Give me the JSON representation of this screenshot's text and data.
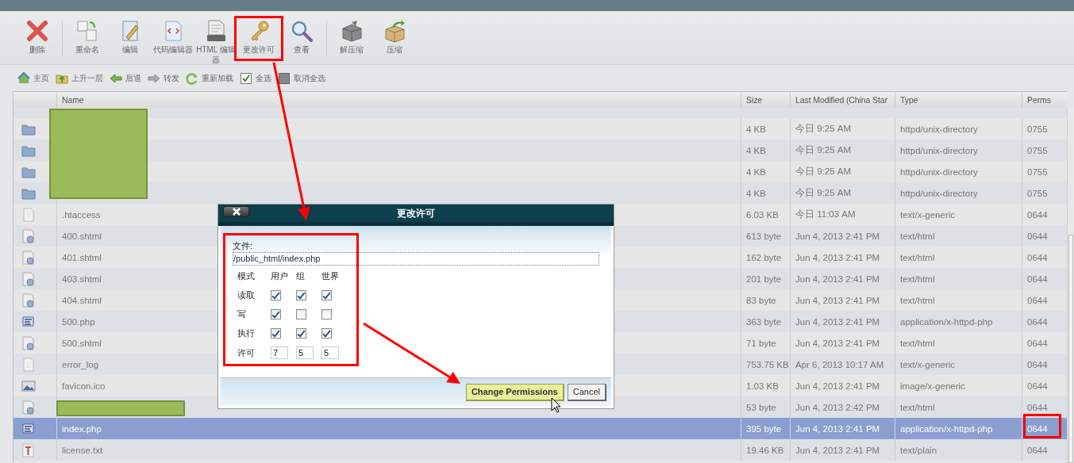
{
  "toolbar": {
    "items": [
      {
        "kind": "delete",
        "label": "删除"
      },
      {
        "kind": "separator"
      },
      {
        "kind": "rename",
        "label": "重命名"
      },
      {
        "kind": "edit",
        "label": "编辑"
      },
      {
        "kind": "code-editor",
        "label": "代码编辑器"
      },
      {
        "kind": "html-editor",
        "label": "HTML 编辑器"
      },
      {
        "kind": "permissions",
        "label": "更改许可"
      },
      {
        "kind": "view",
        "label": "查看"
      },
      {
        "kind": "separator"
      },
      {
        "kind": "extract",
        "label": "解压缩"
      },
      {
        "kind": "compress",
        "label": "压缩"
      }
    ]
  },
  "navbar": {
    "items": [
      {
        "kind": "home",
        "label": "主页"
      },
      {
        "kind": "up",
        "label": "上升一层"
      },
      {
        "kind": "back",
        "label": "后退"
      },
      {
        "kind": "forward",
        "label": "转发"
      },
      {
        "kind": "reload",
        "label": "重新加载"
      },
      {
        "kind": "select-all",
        "label": "全选"
      },
      {
        "kind": "deselect-all",
        "label": "取消全选"
      }
    ]
  },
  "table": {
    "columns": [
      "Name",
      "Size",
      "Last Modified (China Star",
      "Type",
      "Perms"
    ],
    "rows": [
      {
        "kind": "folder",
        "size": "4 KB",
        "modified": "今日 9:25 AM",
        "type": "httpd/unix-directory",
        "perms": "0755",
        "selected": false
      },
      {
        "kind": "folder",
        "size": "4 KB",
        "modified": "今日 9:25 AM",
        "type": "httpd/unix-directory",
        "perms": "0755",
        "selected": false
      },
      {
        "kind": "folder",
        "size": "4 KB",
        "modified": "今日 9:25 AM",
        "type": "httpd/unix-directory",
        "perms": "0755",
        "selected": false
      },
      {
        "kind": "folder",
        "size": "4 KB",
        "modified": "今日 9:25 AM",
        "type": "httpd/unix-directory",
        "perms": "0755",
        "selected": false
      },
      {
        "kind": "doc",
        "name": ".htaccess",
        "size": "6.03 KB",
        "modified": "今日 11:03 AM",
        "type": "text/x-generic",
        "perms": "0644",
        "selected": false
      },
      {
        "kind": "web",
        "name": "400.shtml",
        "size": "613 byte",
        "modified": "Jun 4, 2013 2:41 PM",
        "type": "text/html",
        "perms": "0644",
        "selected": false
      },
      {
        "kind": "web",
        "name": "401.shtml",
        "size": "162 byte",
        "modified": "Jun 4, 2013 2:41 PM",
        "type": "text/html",
        "perms": "0644",
        "selected": false
      },
      {
        "kind": "web",
        "name": "403.shtml",
        "size": "201 byte",
        "modified": "Jun 4, 2013 2:41 PM",
        "type": "text/html",
        "perms": "0644",
        "selected": false
      },
      {
        "kind": "web",
        "name": "404.shtml",
        "size": "83 byte",
        "modified": "Jun 4, 2013 2:41 PM",
        "type": "text/html",
        "perms": "0644",
        "selected": false
      },
      {
        "kind": "php",
        "name": "500.php",
        "size": "363 byte",
        "modified": "Jun 4, 2013 2:41 PM",
        "type": "application/x-httpd-php",
        "perms": "0644",
        "selected": false
      },
      {
        "kind": "web",
        "name": "500.shtml",
        "size": "71 byte",
        "modified": "Jun 4, 2013 2:41 PM",
        "type": "text/html",
        "perms": "0644",
        "selected": false
      },
      {
        "kind": "doc",
        "name": "error_log",
        "size": "753.75 KB",
        "modified": "Apr 6, 2013 10:17 AM",
        "type": "text/x-generic",
        "perms": "0644",
        "selected": false
      },
      {
        "kind": "image",
        "name": "favicon.ico",
        "size": "1.03 KB",
        "modified": "Jun 4, 2013 2:41 PM",
        "type": "image/x-generic",
        "perms": "0644",
        "selected": false
      },
      {
        "kind": "web",
        "size": "53 byte",
        "modified": "Jun 4, 2013 2:42 PM",
        "type": "text/html",
        "perms": "0644",
        "selected": false
      },
      {
        "kind": "php",
        "name": "index.php",
        "size": "395 byte",
        "modified": "Jun 4, 2013 2:41 PM",
        "type": "application/x-httpd-php",
        "perms": "0644",
        "selected": true
      },
      {
        "kind": "text",
        "name": "license.txt",
        "size": "19.46 KB",
        "modified": "Jun 4, 2013 2:41 PM",
        "type": "text/plain",
        "perms": "0644",
        "selected": false
      }
    ]
  },
  "dialog": {
    "title": "更改许可",
    "file_label": "文件:",
    "file_path": "/public_html/index.php",
    "headers": [
      "模式",
      "用户",
      "组",
      "世界"
    ],
    "modes": [
      {
        "label": "读取",
        "user": true,
        "group": true,
        "world": true
      },
      {
        "label": "写",
        "user": true,
        "group": false,
        "world": false
      },
      {
        "label": "执行",
        "user": true,
        "group": true,
        "world": true
      }
    ],
    "permission_label": "许可",
    "permission_values": [
      "7",
      "5",
      "5"
    ],
    "buttons": [
      {
        "kind": "primary",
        "label": "Change Permissions"
      },
      {
        "kind": "secondary",
        "label": "Cancel"
      }
    ]
  },
  "annotations": [
    {
      "kind": "box"
    },
    {
      "kind": "arrow"
    },
    {
      "kind": "box"
    },
    {
      "kind": "arrow"
    },
    {
      "kind": "box"
    },
    {
      "kind": "redaction"
    },
    {
      "kind": "redaction"
    },
    {
      "kind": "cursor"
    }
  ]
}
